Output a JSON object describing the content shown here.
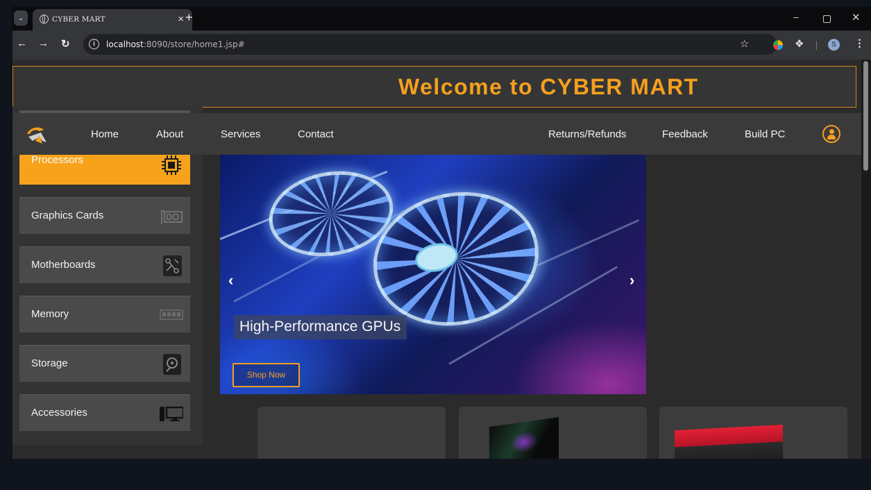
{
  "browser": {
    "tab_title": "CYBER MART",
    "url_host": "localhost",
    "url_rest": ":8090/store/home1.jsp#",
    "profile_initial": "S",
    "tab_close": "×",
    "new_tab": "+"
  },
  "header": {
    "welcome": "Welcome to CYBER MART"
  },
  "nav": {
    "links": [
      "Home",
      "About",
      "Services",
      "Contact",
      "Returns/Refunds",
      "Feedback",
      "Build PC"
    ]
  },
  "sidebar": {
    "items": [
      {
        "label": "Processors",
        "icon": "cpu-icon",
        "active": true
      },
      {
        "label": "Graphics Cards",
        "icon": "graphics-card-icon",
        "active": false
      },
      {
        "label": "Motherboards",
        "icon": "motherboard-icon",
        "active": false
      },
      {
        "label": "Memory",
        "icon": "memory-icon",
        "active": false
      },
      {
        "label": "Storage",
        "icon": "storage-icon",
        "active": false
      },
      {
        "label": "Accessories",
        "icon": "desktop-icon",
        "active": false
      }
    ]
  },
  "carousel": {
    "caption": "High-Performance GPUs",
    "button": "Shop Now",
    "prev": "‹",
    "next": "›"
  },
  "colors": {
    "accent": "#f6a01d",
    "page_bg": "#2b2b2b",
    "nav_bg": "#3a3a3a"
  }
}
